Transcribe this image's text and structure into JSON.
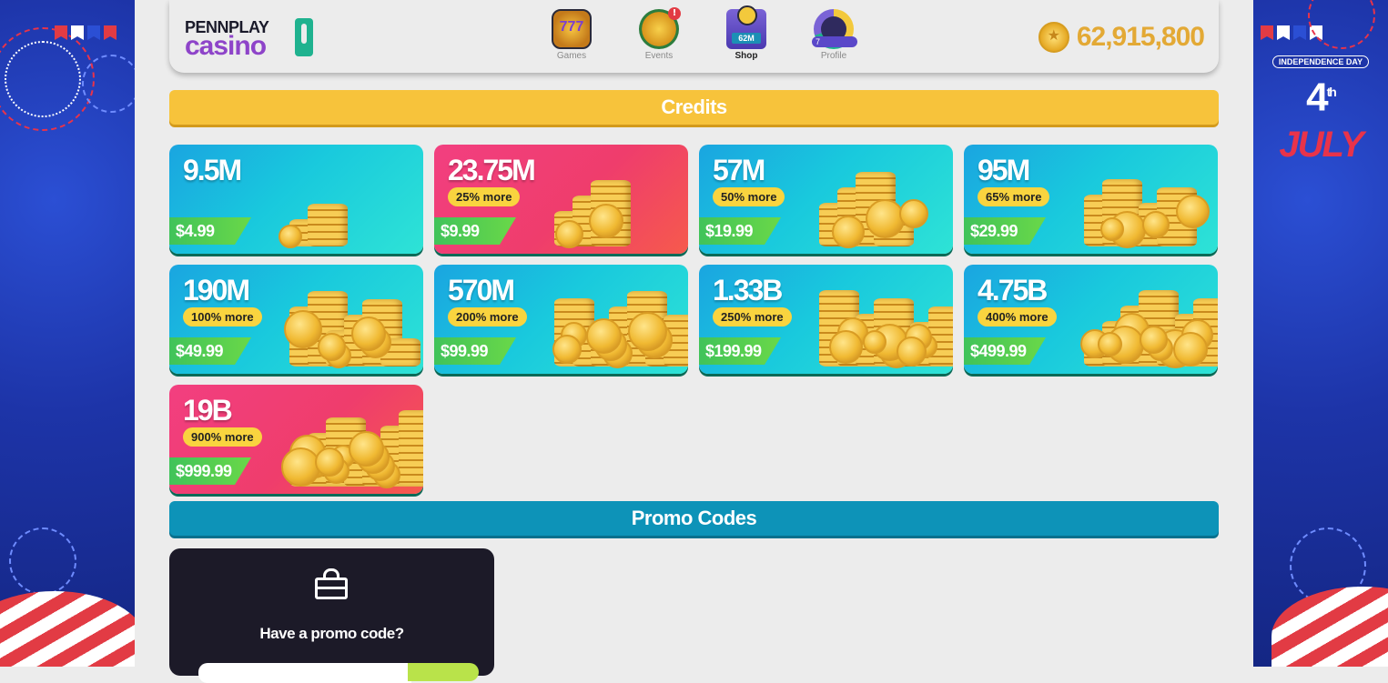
{
  "side_banner": {
    "tag": "INDEPENDENCE DAY",
    "day_number": "4",
    "day_suffix": "th",
    "month": "JULY"
  },
  "header": {
    "logo_top": "PENNPLAY",
    "logo_bottom": "casino",
    "nav": [
      {
        "label": "Games",
        "icon": "slot-machine-icon",
        "icon_text": "777"
      },
      {
        "label": "Events",
        "icon": "trophy-icon",
        "badge": "!"
      },
      {
        "label": "Shop",
        "icon": "shop-icon",
        "icon_text": "62M"
      },
      {
        "label": "Profile",
        "icon": "profile-level-icon",
        "icon_text": "7"
      }
    ],
    "active_nav": "Shop",
    "balance": "62,915,800"
  },
  "sections": {
    "credits": "Credits",
    "promo": "Promo Codes"
  },
  "packages": [
    {
      "amount": "9.5M",
      "bonus": "",
      "price": "$4.99",
      "style": "blue"
    },
    {
      "amount": "23.75M",
      "bonus": "25% more",
      "price": "$9.99",
      "style": "pink"
    },
    {
      "amount": "57M",
      "bonus": "50% more",
      "price": "$19.99",
      "style": "blue"
    },
    {
      "amount": "95M",
      "bonus": "65% more",
      "price": "$29.99",
      "style": "blue"
    },
    {
      "amount": "190M",
      "bonus": "100% more",
      "price": "$49.99",
      "style": "blue"
    },
    {
      "amount": "570M",
      "bonus": "200% more",
      "price": "$99.99",
      "style": "blue"
    },
    {
      "amount": "1.33B",
      "bonus": "250% more",
      "price": "$199.99",
      "style": "blue"
    },
    {
      "amount": "4.75B",
      "bonus": "400% more",
      "price": "$499.99",
      "style": "blue"
    },
    {
      "amount": "19B",
      "bonus": "900% more",
      "price": "$999.99",
      "style": "pink"
    }
  ],
  "promo": {
    "title": "Have a promo code?",
    "input_value": "",
    "submit_label": ""
  },
  "colors": {
    "credits_bar": "#f7c33b",
    "promo_bar": "#0d93b8",
    "balance": "#e3a935",
    "price_tag": "#40c35a",
    "bonus_pill": "#f9d43f"
  }
}
